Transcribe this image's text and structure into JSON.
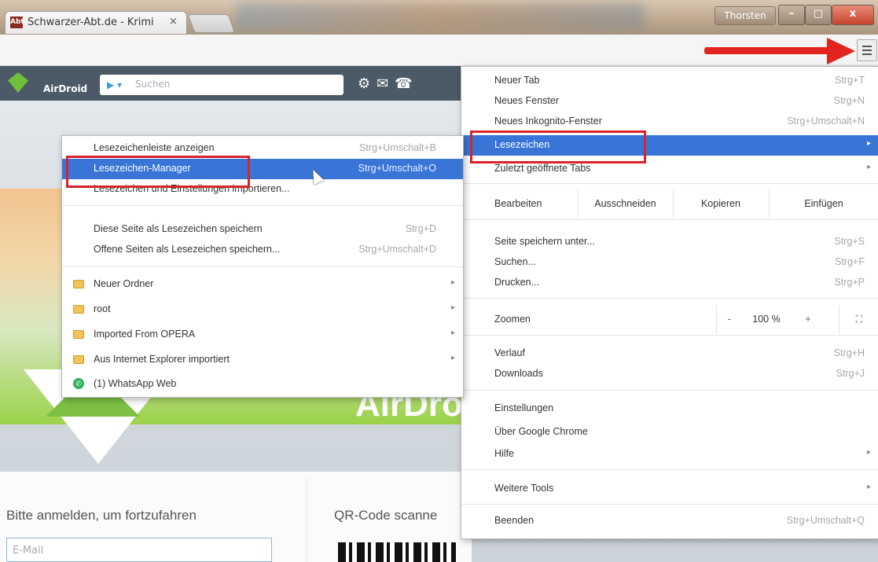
{
  "window": {
    "tab_title": "Schwarzer-Abt.de - Krimi",
    "tab_close": "×",
    "tab_favicon": "Abt",
    "user_button": "Thorsten",
    "minimize": "–",
    "maximize": "□",
    "close": "x"
  },
  "page": {
    "airdroid_label": "AirDroid",
    "search_placeholder": "Suchen",
    "login_text": "Bitte anmelden, um fortzufahren",
    "qr_text": "QR-Code scanne",
    "email_placeholder": "E-Mail",
    "big_text": "AirDro"
  },
  "colors": {
    "accent": "#3875d7",
    "highlight_box": "#d8232a",
    "arrow": "#e3231d"
  },
  "main_menu": {
    "items_top": [
      {
        "label": "Neuer Tab",
        "shortcut": "Strg+T"
      },
      {
        "label": "Neues Fenster",
        "shortcut": "Strg+N"
      },
      {
        "label": "Neues Inkognito-Fenster",
        "shortcut": "Strg+Umschalt+N"
      },
      {
        "label": "Lesezeichen",
        "shortcut": ""
      },
      {
        "label": "Zuletzt geöffnete Tabs",
        "shortcut": ""
      }
    ],
    "edit": {
      "label": "Bearbeiten",
      "cut": "Ausschneiden",
      "copy": "Kopieren",
      "paste": "Einfügen"
    },
    "items_mid": [
      {
        "label": "Seite speichern unter...",
        "shortcut": "Strg+S"
      },
      {
        "label": "Suchen...",
        "shortcut": "Strg+F"
      },
      {
        "label": "Drucken...",
        "shortcut": "Strg+P"
      }
    ],
    "zoom": {
      "label": "Zoomen",
      "minus": "-",
      "value": "100 %",
      "plus": "+",
      "fullscreen": "⛶"
    },
    "items_hist": [
      {
        "label": "Verlauf",
        "shortcut": "Strg+H"
      },
      {
        "label": "Downloads",
        "shortcut": "Strg+J"
      }
    ],
    "items_settings": [
      {
        "label": "Einstellungen"
      },
      {
        "label": "Über Google Chrome"
      },
      {
        "label": "Hilfe"
      }
    ],
    "more_tools": "Weitere Tools",
    "exit": {
      "label": "Beenden",
      "shortcut": "Strg+Umschalt+Q"
    },
    "submenu_arrow": "▸"
  },
  "bookmarks_menu": {
    "items_top": [
      {
        "label": "Lesezeichenleiste anzeigen",
        "shortcut": "Strg+Umschalt+B"
      },
      {
        "label": "Lesezeichen-Manager",
        "shortcut": "Strg+Umschalt+O"
      },
      {
        "label": "Lesezeichen und Einstellungen importieren...",
        "shortcut": ""
      }
    ],
    "items_save": [
      {
        "label": "Diese Seite als Lesezeichen speichern",
        "shortcut": "Strg+D"
      },
      {
        "label": "Offene Seiten als Lesezeichen speichern...",
        "shortcut": "Strg+Umschalt+D"
      }
    ],
    "folders": [
      {
        "label": "Neuer Ordner"
      },
      {
        "label": "root"
      },
      {
        "label": "Imported From OPERA"
      },
      {
        "label": "Aus Internet Explorer importiert"
      }
    ],
    "whatsapp": "(1) WhatsApp Web"
  }
}
